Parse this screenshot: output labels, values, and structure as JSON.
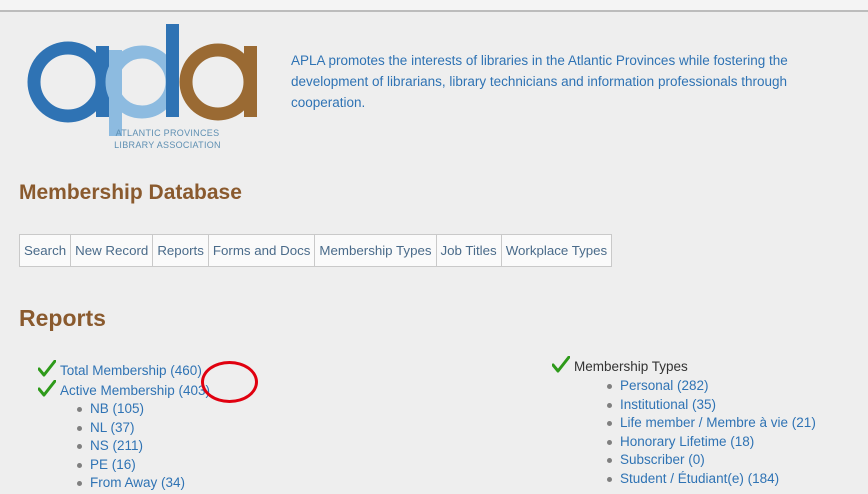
{
  "header": {
    "logo": {
      "mark": "apla",
      "subtitle_line1": "ATLANTIC PROVINCES",
      "subtitle_line2": "LIBRARY ASSOCIATION",
      "colors": {
        "blue": "#2f73b4",
        "light_blue": "#8dbbe0",
        "brown": "#9a6a33"
      }
    },
    "tagline": "APLA promotes the interests of libraries in the Atlantic Provinces while fostering the development of librarians, library technicians and information professionals through cooperation."
  },
  "page_title": "Membership Database",
  "nav": {
    "items": [
      "Search",
      "New Record",
      "Reports",
      "Forms and Docs",
      "Membership Types",
      "Job Titles",
      "Workplace Types"
    ]
  },
  "reports": {
    "heading": "Reports",
    "total_membership": "Total Membership (460)",
    "active_membership": "Active Membership (403)",
    "provinces": [
      "NB (105)",
      "NL (37)",
      "NS (211)",
      "PE (16)",
      "From Away (34)"
    ],
    "membership_types_label": "Membership Types",
    "membership_types": [
      "Personal (282)",
      "Institutional (35)",
      "Life member / Membre à vie (21)",
      "Honorary Lifetime (18)",
      "Subscriber (0)",
      "Student / Étudiant(e) (184)"
    ]
  },
  "icons": {
    "check": "check-icon",
    "highlight": "red-circle-annotation"
  },
  "colors": {
    "heading": "#8a5a2e",
    "link": "#2f73b4",
    "check": "#2e9a1a",
    "annotation": "#e0000f"
  }
}
